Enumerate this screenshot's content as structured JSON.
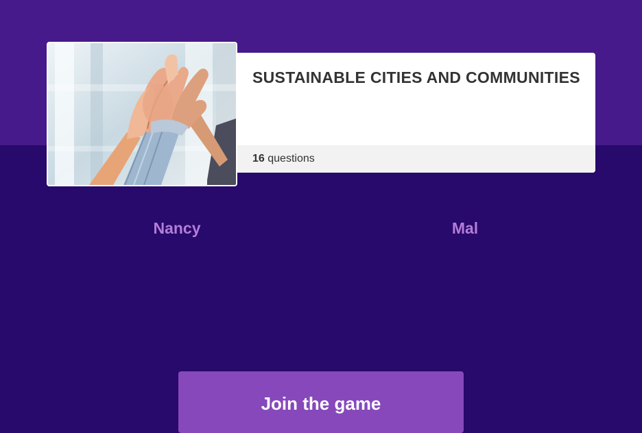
{
  "quiz": {
    "title": "SUSTAINABLE CITIES AND COMMUNITIES",
    "question_count": "16",
    "question_label": "questions",
    "image_icon": "hands-high-five-photo"
  },
  "players": [
    {
      "name": "Nancy"
    },
    {
      "name": "Mal"
    }
  ],
  "join_button": {
    "label": "Join the game"
  },
  "colors": {
    "top_band": "#461a8a",
    "background": "#28096c",
    "player_name": "#b27ed8",
    "join_button": "#8648bb"
  }
}
